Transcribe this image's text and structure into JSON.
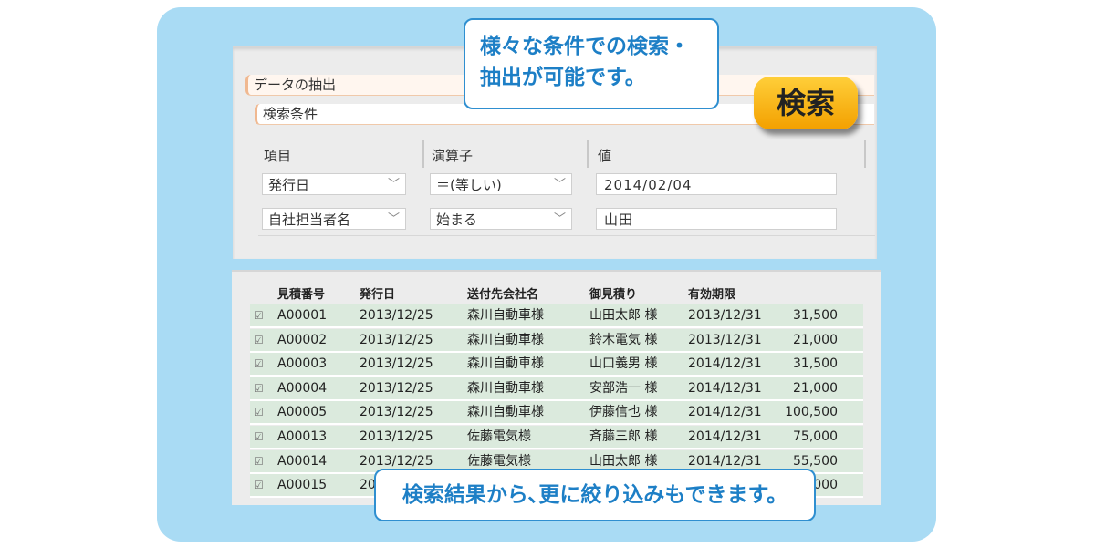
{
  "top_callout": {
    "line1": "様々な条件での検索・",
    "line2": "抽出が可能です。"
  },
  "bottom_callout": "検索結果から､更に絞り込みもできます。",
  "search_button": "検索",
  "search_panel": {
    "extract_label": "データの抽出",
    "condition_label": "検索条件",
    "columns": [
      "項目",
      "演算子",
      "値"
    ],
    "conditions": [
      {
        "field": "発行日",
        "operator": "＝(等しい)",
        "value": "2014/02/04"
      },
      {
        "field": "自社担当者名",
        "operator": "始まる",
        "value": "山田"
      }
    ]
  },
  "results": {
    "headers": [
      "見積番号",
      "発行日",
      "送付先会社名",
      "御見積り",
      "有効期限"
    ],
    "rows": [
      {
        "no": "A00001",
        "date": "2013/12/25",
        "company": "森川自動車様",
        "person": "山田太郎 様",
        "expiry": "2013/12/31",
        "amount": "31,500"
      },
      {
        "no": "A00002",
        "date": "2013/12/25",
        "company": "森川自動車様",
        "person": "鈴木電気 様",
        "expiry": "2013/12/31",
        "amount": "21,000"
      },
      {
        "no": "A00003",
        "date": "2013/12/25",
        "company": "森川自動車様",
        "person": "山口義男 様",
        "expiry": "2014/12/31",
        "amount": "31,500"
      },
      {
        "no": "A00004",
        "date": "2013/12/25",
        "company": "森川自動車様",
        "person": "安部浩一 様",
        "expiry": "2014/12/31",
        "amount": "21,000"
      },
      {
        "no": "A00005",
        "date": "2013/12/25",
        "company": "森川自動車様",
        "person": "伊藤信也 様",
        "expiry": "2014/12/31",
        "amount": "100,500"
      },
      {
        "no": "A00013",
        "date": "2013/12/25",
        "company": "佐藤電気様",
        "person": "斉藤三郎 様",
        "expiry": "2014/12/31",
        "amount": "75,000"
      },
      {
        "no": "A00014",
        "date": "2013/12/25",
        "company": "佐藤電気様",
        "person": "山田太郎 様",
        "expiry": "2014/12/31",
        "amount": "55,500"
      },
      {
        "no": "A00015",
        "date": "20",
        "company": "",
        "person": "",
        "expiry": "",
        "amount": ",000"
      }
    ]
  }
}
